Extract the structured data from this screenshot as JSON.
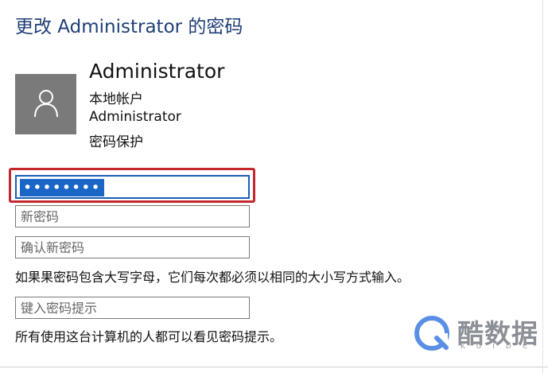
{
  "dialog": {
    "title": "更改 Administrator 的密码"
  },
  "account": {
    "name": "Administrator",
    "type": "本地帐户",
    "username": "Administrator",
    "protection": "密码保护",
    "avatar_icon": "user-icon"
  },
  "form": {
    "current_password_masked": "••••••••",
    "new_password_placeholder": "新密码",
    "confirm_password_placeholder": "确认新密码",
    "case_note": "如果果密码包含大写字母，它们每次都必须以相同的大小写方式输入。",
    "hint_placeholder": "键入密码提示",
    "hint_note": "所有使用这台计算机的人都可以看见密码提示。"
  },
  "watermark": {
    "brand": "酷数据",
    "sub": "KUIDC"
  },
  "colors": {
    "title": "#1f3f77",
    "highlight_border": "#c4282e",
    "selection": "#1a66c7",
    "avatar_bg": "#7a7a7a"
  }
}
